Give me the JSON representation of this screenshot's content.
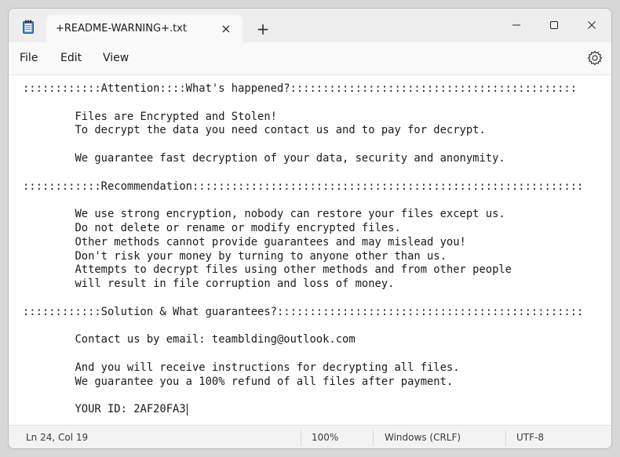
{
  "window": {
    "tab_title": "+README-WARNING+.txt",
    "new_tab_symbol": "+",
    "tab_close_symbol": "×"
  },
  "icons": {
    "app": "notepad-icon",
    "tab_close": "close-icon",
    "new_tab": "plus-icon",
    "minimize": "minimize-icon",
    "maximize": "maximize-icon",
    "close": "close-icon",
    "settings": "gear-icon"
  },
  "menu": {
    "file": "File",
    "edit": "Edit",
    "view": "View"
  },
  "editor": {
    "lines": [
      "::::::::::::Attention::::What's happened?::::::::::::::::::::::::::::::::::::::::::::",
      "",
      "        Files are Encrypted and Stolen!",
      "        To decrypt the data you need contact us and to pay for decrypt.",
      "",
      "        We guarantee fast decryption of your data, security and anonymity.",
      "",
      "::::::::::::Recommendation::::::::::::::::::::::::::::::::::::::::::::::::::::::::::::",
      "",
      "        We use strong encryption, nobody can restore your files except us.",
      "        Do not delete or rename or modify encrypted files.",
      "        Other methods cannot provide guarantees and may mislead you!",
      "        Don't risk your money by turning to anyone other than us.",
      "        Attempts to decrypt files using other methods and from other people",
      "        will result in file corruption and loss of money.",
      "",
      "::::::::::::Solution & What guarantees?:::::::::::::::::::::::::::::::::::::::::::::::",
      "",
      "        Contact us by email: teamblding@outlook.com",
      "",
      "        And you will receive instructions for decrypting all files.",
      "        We guarantee you a 100% refund of all files after payment.",
      "",
      "        YOUR ID: 2AF20FA3"
    ]
  },
  "status": {
    "position": "Ln 24, Col 19",
    "zoom": "100%",
    "line_ending": "Windows (CRLF)",
    "encoding": "UTF-8"
  },
  "colors": {
    "titlebar": "#eeeeee",
    "menubar": "#f9f9f9",
    "editor_bg": "#ffffff",
    "statusbar": "#f3f3f3"
  }
}
